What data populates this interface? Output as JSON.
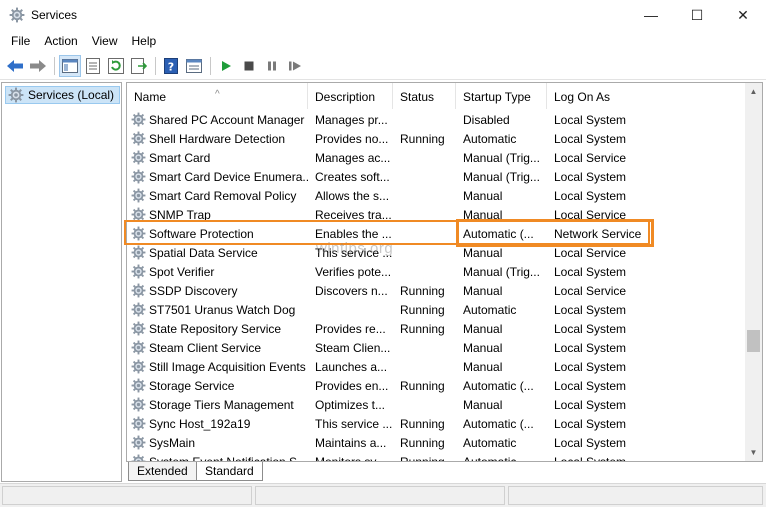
{
  "window": {
    "title": "Services",
    "minimize": "—",
    "maximize": "☐",
    "close": "✕"
  },
  "menu": [
    "File",
    "Action",
    "View",
    "Help"
  ],
  "tree": {
    "label": "Services (Local)"
  },
  "columns": {
    "name": "Name",
    "description": "Description",
    "status": "Status",
    "startup": "Startup Type",
    "logon": "Log On As"
  },
  "rows": [
    {
      "name": "Shared PC Account Manager",
      "desc": "Manages pr...",
      "status": "",
      "startup": "Disabled",
      "logon": "Local System"
    },
    {
      "name": "Shell Hardware Detection",
      "desc": "Provides no...",
      "status": "Running",
      "startup": "Automatic",
      "logon": "Local System"
    },
    {
      "name": "Smart Card",
      "desc": "Manages ac...",
      "status": "",
      "startup": "Manual (Trig...",
      "logon": "Local Service"
    },
    {
      "name": "Smart Card Device Enumera...",
      "desc": "Creates soft...",
      "status": "",
      "startup": "Manual (Trig...",
      "logon": "Local System"
    },
    {
      "name": "Smart Card Removal Policy",
      "desc": "Allows the s...",
      "status": "",
      "startup": "Manual",
      "logon": "Local System"
    },
    {
      "name": "SNMP Trap",
      "desc": "Receives tra...",
      "status": "",
      "startup": "Manual",
      "logon": "Local Service"
    },
    {
      "name": "Software Protection",
      "desc": "Enables the ...",
      "status": "",
      "startup": "Automatic (...",
      "logon": "Network Service"
    },
    {
      "name": "Spatial Data Service",
      "desc": "This service ...",
      "status": "",
      "startup": "Manual",
      "logon": "Local Service"
    },
    {
      "name": "Spot Verifier",
      "desc": "Verifies pote...",
      "status": "",
      "startup": "Manual (Trig...",
      "logon": "Local System"
    },
    {
      "name": "SSDP Discovery",
      "desc": "Discovers n...",
      "status": "Running",
      "startup": "Manual",
      "logon": "Local Service"
    },
    {
      "name": "ST7501 Uranus Watch Dog",
      "desc": "",
      "status": "Running",
      "startup": "Automatic",
      "logon": "Local System"
    },
    {
      "name": "State Repository Service",
      "desc": "Provides re...",
      "status": "Running",
      "startup": "Manual",
      "logon": "Local System"
    },
    {
      "name": "Steam Client Service",
      "desc": "Steam Clien...",
      "status": "",
      "startup": "Manual",
      "logon": "Local System"
    },
    {
      "name": "Still Image Acquisition Events",
      "desc": "Launches a...",
      "status": "",
      "startup": "Manual",
      "logon": "Local System"
    },
    {
      "name": "Storage Service",
      "desc": "Provides en...",
      "status": "Running",
      "startup": "Automatic (...",
      "logon": "Local System"
    },
    {
      "name": "Storage Tiers Management",
      "desc": "Optimizes t...",
      "status": "",
      "startup": "Manual",
      "logon": "Local System"
    },
    {
      "name": "Sync Host_192a19",
      "desc": "This service ...",
      "status": "Running",
      "startup": "Automatic (...",
      "logon": "Local System"
    },
    {
      "name": "SysMain",
      "desc": "Maintains a...",
      "status": "Running",
      "startup": "Automatic",
      "logon": "Local System"
    },
    {
      "name": "System Event Notification S...",
      "desc": "Monitors sy...",
      "status": "Running",
      "startup": "Automatic",
      "logon": "Local System"
    }
  ],
  "tabs": [
    "Extended",
    "Standard"
  ],
  "watermark": "wintips.org",
  "colors": {
    "highlight": "#f08a24",
    "selection": "#cce4f7"
  },
  "icons": {
    "app": "gear-icon",
    "row": "gear-icon"
  }
}
